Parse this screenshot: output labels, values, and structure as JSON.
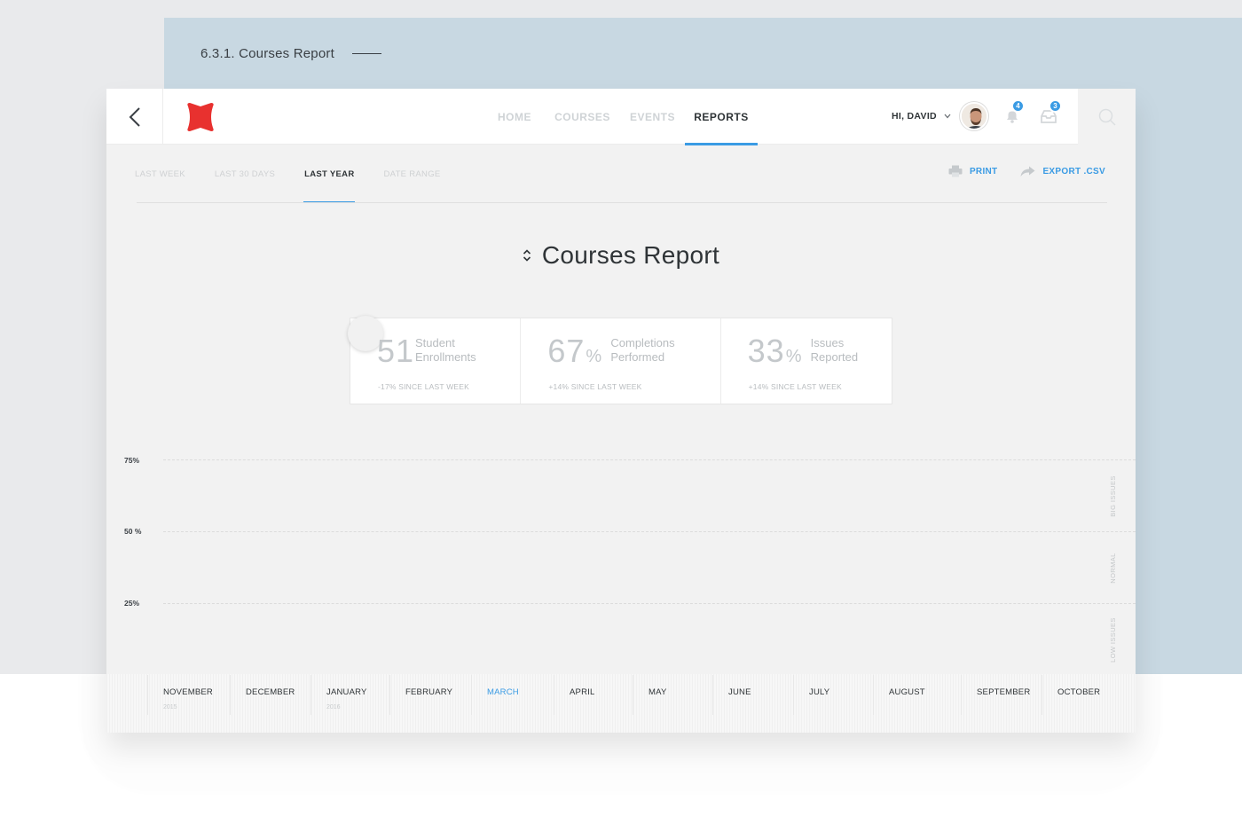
{
  "caption": "6.3.1. Courses Report",
  "nav": {
    "back": "back",
    "items": [
      "HOME",
      "COURSES",
      "EVENTS",
      "REPORTS"
    ],
    "active": "REPORTS"
  },
  "user": {
    "greeting": "HI, DAVID",
    "notifications": "4",
    "messages": "3"
  },
  "filters": {
    "items": [
      "LAST WEEK",
      "LAST 30 DAYS",
      "LAST YEAR",
      "DATE RANGE"
    ],
    "active": "LAST YEAR"
  },
  "actions": {
    "print": "PRINT",
    "export": "EXPORT .CSV"
  },
  "title": "Courses Report",
  "stats": [
    {
      "value": "51",
      "unit": "",
      "label": "Student Enrollments",
      "label1": "Student",
      "label2": "Enrollments",
      "since": "-17% SINCE LAST WEEK"
    },
    {
      "value": "67",
      "unit": "%",
      "label": "Completions Performed",
      "label1": "Completions",
      "label2": "Performed",
      "since": "+14% SINCE LAST WEEK"
    },
    {
      "value": "33",
      "unit": "%",
      "label": "Issues Reported",
      "label1": "Issues",
      "label2": "Reported",
      "since": "+14% SINCE LAST WEEK"
    }
  ],
  "chart": {
    "y_ticks": [
      "75%",
      "50 %",
      "25%"
    ],
    "zones": [
      "BIG ISSUES",
      "NORMAL",
      "LOW ISSUES"
    ],
    "months": [
      {
        "name": "NOVEMBER",
        "year": "2015"
      },
      {
        "name": "DECEMBER",
        "year": ""
      },
      {
        "name": "JANUARY",
        "year": "2016"
      },
      {
        "name": "FEBRUARY",
        "year": ""
      },
      {
        "name": "MARCH",
        "year": ""
      },
      {
        "name": "APRIL",
        "year": ""
      },
      {
        "name": "MAY",
        "year": ""
      },
      {
        "name": "JUNE",
        "year": ""
      },
      {
        "name": "JULY",
        "year": ""
      },
      {
        "name": "AUGUST",
        "year": ""
      },
      {
        "name": "SEPTEMBER",
        "year": ""
      },
      {
        "name": "OCTOBER",
        "year": ""
      }
    ],
    "active_month": "MARCH"
  },
  "colors": {
    "accent": "#3a9be4",
    "logo": "#e8312f",
    "text": "#2f3437"
  },
  "icons": [
    "back-arrow-icon",
    "logo-icon",
    "chevron-down-icon",
    "bell-icon",
    "inbox-icon",
    "search-icon",
    "printer-icon",
    "share-arrow-icon",
    "sort-icon"
  ]
}
